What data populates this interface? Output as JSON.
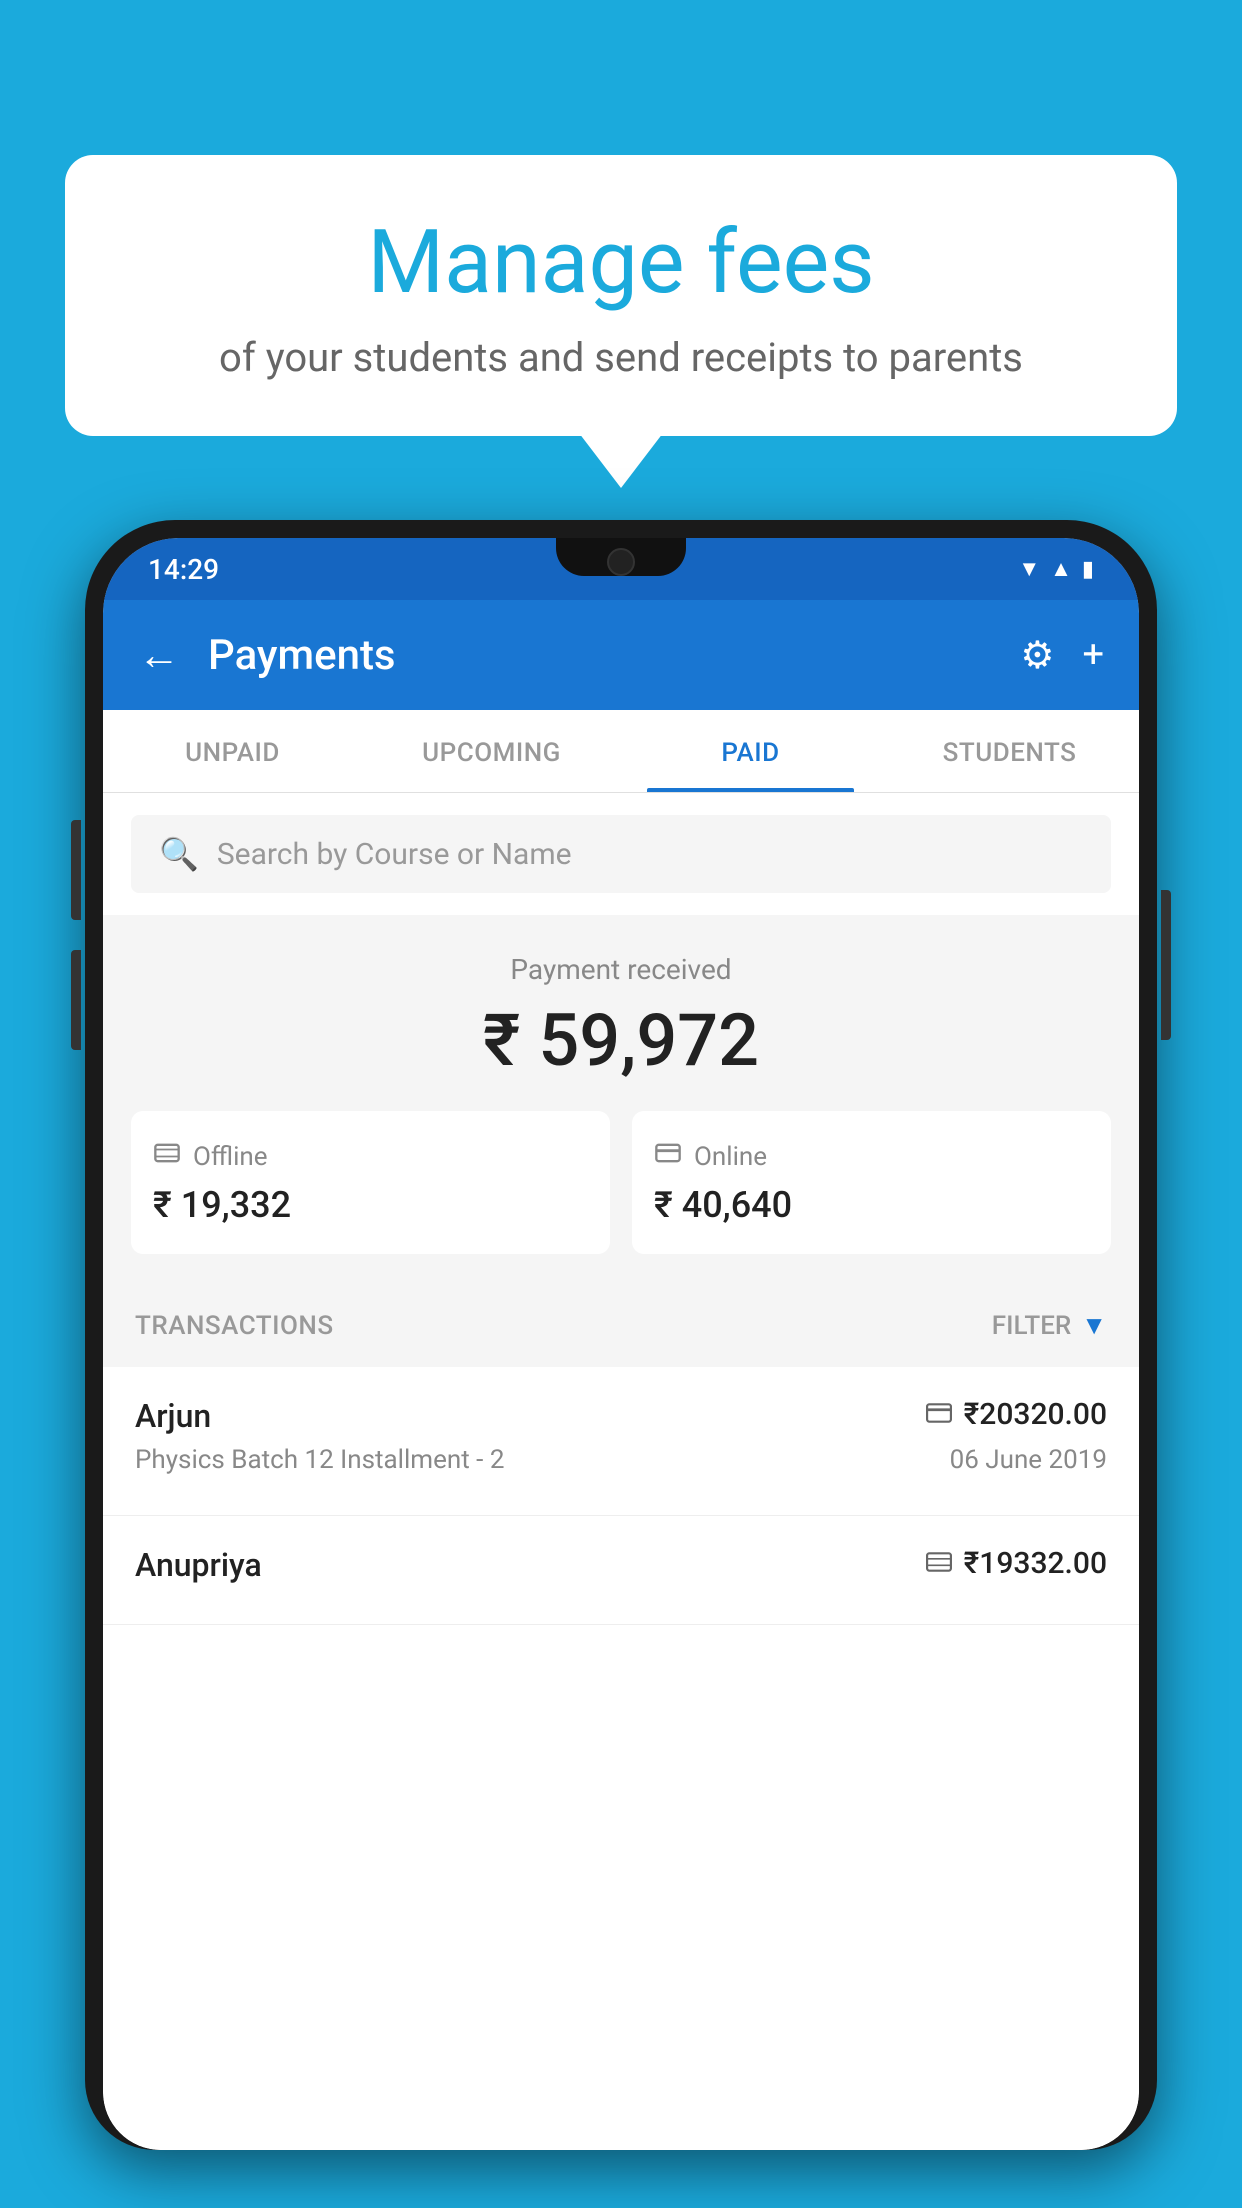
{
  "background_color": "#1BAADC",
  "bubble": {
    "title": "Manage fees",
    "subtitle": "of your students and send receipts to parents"
  },
  "status_bar": {
    "time": "14:29",
    "icons": [
      "wifi",
      "signal",
      "battery"
    ]
  },
  "app_bar": {
    "title": "Payments",
    "back_icon": "←",
    "settings_icon": "⚙",
    "add_icon": "+"
  },
  "tabs": [
    {
      "label": "UNPAID",
      "active": false
    },
    {
      "label": "UPCOMING",
      "active": false
    },
    {
      "label": "PAID",
      "active": true
    },
    {
      "label": "STUDENTS",
      "active": false
    }
  ],
  "search": {
    "placeholder": "Search by Course or Name"
  },
  "payment_summary": {
    "label": "Payment received",
    "amount": "₹ 59,972",
    "offline": {
      "icon": "💳",
      "label": "Offline",
      "amount": "₹ 19,332"
    },
    "online": {
      "icon": "💳",
      "label": "Online",
      "amount": "₹ 40,640"
    }
  },
  "transactions": {
    "header_label": "TRANSACTIONS",
    "filter_label": "FILTER",
    "items": [
      {
        "name": "Arjun",
        "detail": "Physics Batch 12 Installment - 2",
        "amount": "₹20320.00",
        "date": "06 June 2019",
        "type": "online"
      },
      {
        "name": "Anupriya",
        "detail": "",
        "amount": "₹19332.00",
        "date": "",
        "type": "offline"
      }
    ]
  }
}
